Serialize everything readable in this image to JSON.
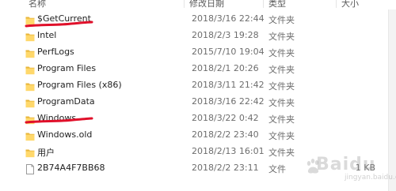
{
  "colors": {
    "folder_body": "#ffd86b",
    "folder_tab": "#e8b63a",
    "marker": "#e0102a"
  },
  "header": {
    "name_label": "名称",
    "modified_label": "修改日期",
    "type_label": "类型",
    "size_label": "大小"
  },
  "files": [
    {
      "name": "$GetCurrent",
      "modified": "2018/3/16 22:44",
      "type": "文件夹",
      "size": "",
      "icon": "folder-icon"
    },
    {
      "name": "Intel",
      "modified": "2018/2/3 19:28",
      "type": "文件夹",
      "size": "",
      "icon": "folder-icon"
    },
    {
      "name": "PerfLogs",
      "modified": "2015/7/10 19:04",
      "type": "文件夹",
      "size": "",
      "icon": "folder-icon"
    },
    {
      "name": "Program Files",
      "modified": "2018/2/1 20:26",
      "type": "文件夹",
      "size": "",
      "icon": "folder-icon"
    },
    {
      "name": "Program Files (x86)",
      "modified": "2018/3/11 21:42",
      "type": "文件夹",
      "size": "",
      "icon": "folder-icon"
    },
    {
      "name": "ProgramData",
      "modified": "2018/3/16 22:42",
      "type": "文件夹",
      "size": "",
      "icon": "folder-icon"
    },
    {
      "name": "Windows",
      "modified": "2018/3/22 0:42",
      "type": "文件夹",
      "size": "",
      "icon": "folder-icon"
    },
    {
      "name": "Windows.old",
      "modified": "2018/2/2 23:40",
      "type": "文件夹",
      "size": "",
      "icon": "folder-icon"
    },
    {
      "name": "用户",
      "modified": "2018/2/13 16:01",
      "type": "文件夹",
      "size": "",
      "icon": "folder-icon"
    },
    {
      "name": "2B74A4F7BB68",
      "modified": "2018/2/2 23:11",
      "type": "文件",
      "size": "1 KB",
      "icon": "file-icon"
    }
  ],
  "watermark": {
    "brand": "Baidu",
    "sub": "jingyan.baidu.com"
  }
}
